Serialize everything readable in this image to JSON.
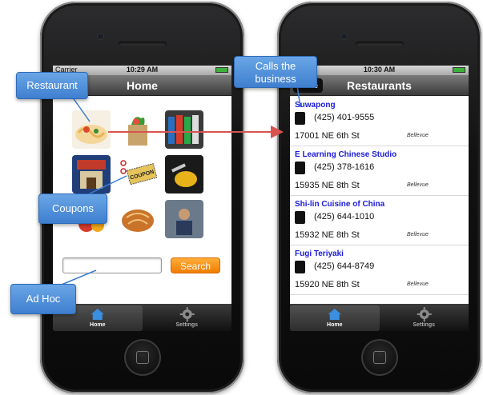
{
  "left_phone": {
    "status": {
      "carrier": "Carrier",
      "time": "10:29 AM"
    },
    "navbar_title": "Home",
    "search": {
      "placeholder": "",
      "button_label": "Search"
    },
    "tabs": [
      {
        "label": "Home",
        "icon": "house-icon",
        "active": true
      },
      {
        "label": "Settings",
        "icon": "gear-icon",
        "active": false
      }
    ]
  },
  "right_phone": {
    "status": {
      "time": "10:30 AM"
    },
    "navbar_title": "Restaurants",
    "back_label": "Home",
    "restaurants": [
      {
        "name": "Suwapong",
        "phone": "(425) 401-9555",
        "address": "17001 NE 6th St",
        "city": "Bellevue"
      },
      {
        "name": "E Learning Chinese Studio",
        "phone": "(425) 378-1616",
        "address": "15935 NE 8th St",
        "city": "Bellevue"
      },
      {
        "name": "Shi-lin Cuisine of China",
        "phone": "(425) 644-1010",
        "address": "15932 NE 8th St",
        "city": "Bellevue"
      },
      {
        "name": "Fugi Teriyaki",
        "phone": "(425) 644-8749",
        "address": "15920 NE 8th St",
        "city": "Bellevue"
      }
    ],
    "tabs": [
      {
        "label": "Home",
        "icon": "house-icon",
        "active": true
      },
      {
        "label": "Settings",
        "icon": "gear-icon",
        "active": false
      }
    ]
  },
  "callouts": {
    "restaurant": "Restaurant",
    "coupons": "Coupons",
    "ad_hoc": "Ad Hoc",
    "calls_line1": "Calls the",
    "calls_line2": "business"
  },
  "colors": {
    "callout": "#4a8ad8",
    "search_button": "#f48a10",
    "link": "#1a1ad6",
    "arrow": "#d9534f"
  }
}
